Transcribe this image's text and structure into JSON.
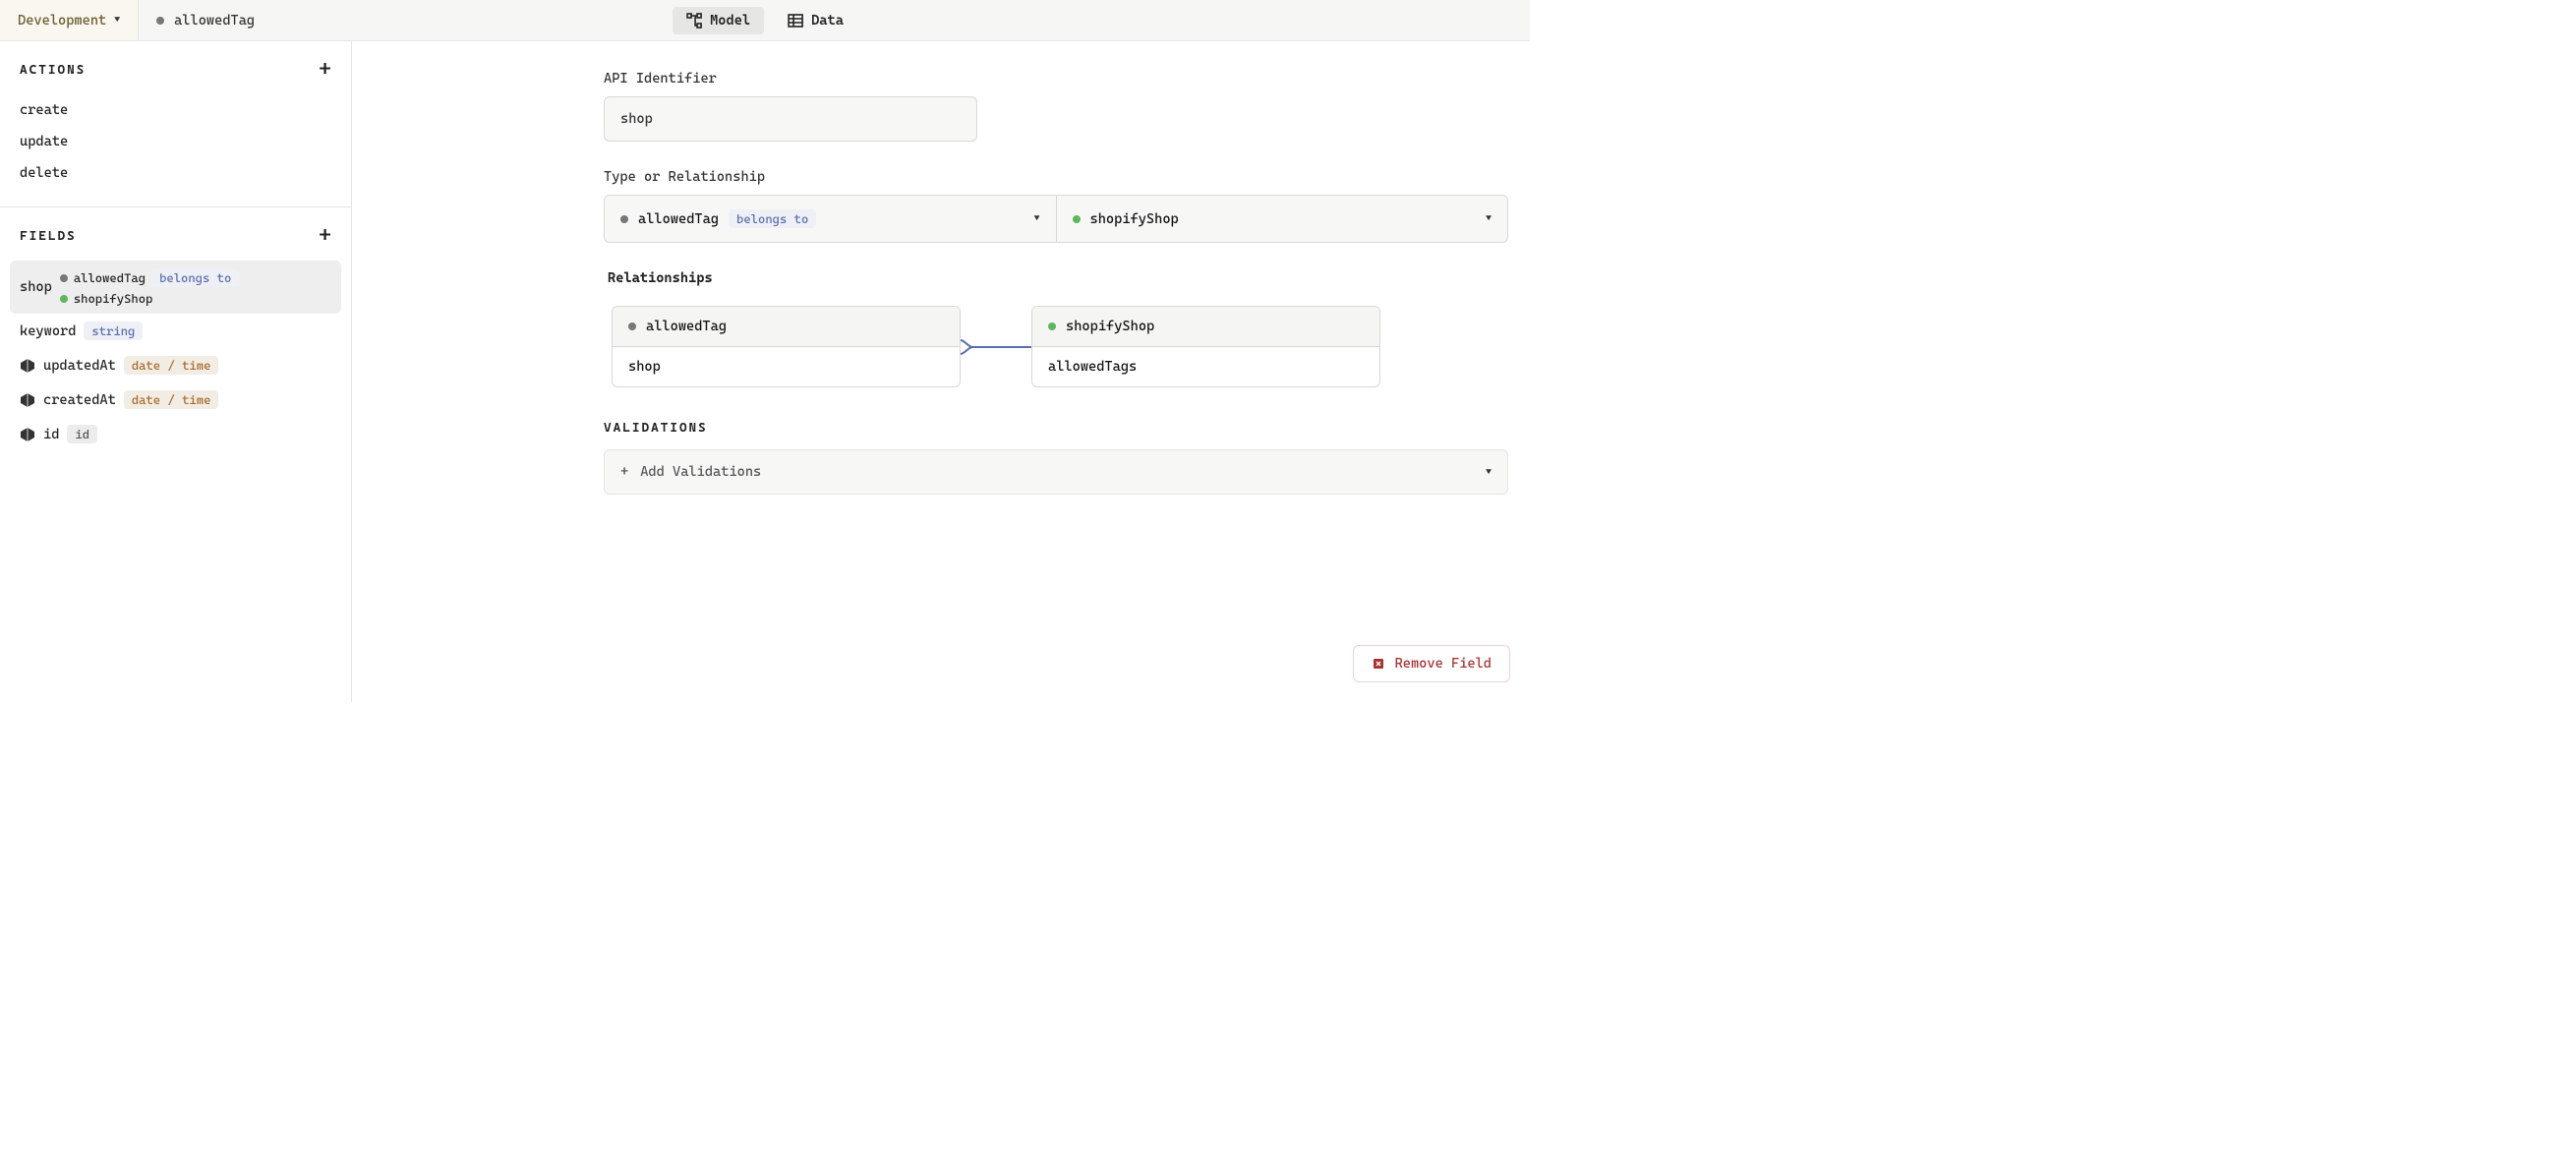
{
  "topbar": {
    "env_label": "Development",
    "breadcrumb_model": "allowedTag",
    "tabs": {
      "model": "Model",
      "data": "Data"
    }
  },
  "sidebar": {
    "actions": {
      "title": "ACTIONS",
      "items": [
        "create",
        "update",
        "delete"
      ]
    },
    "fields": {
      "title": "FIELDS",
      "items": [
        {
          "name": "shop",
          "selected": true,
          "rel": {
            "from": "allowedTag",
            "type": "belongs to",
            "to": "shopifyShop"
          }
        },
        {
          "name": "keyword",
          "badge": "string",
          "badgeClass": ""
        },
        {
          "name": "updatedAt",
          "badge": "date / time",
          "badgeClass": "orange",
          "sys": true
        },
        {
          "name": "createdAt",
          "badge": "date / time",
          "badgeClass": "orange",
          "sys": true
        },
        {
          "name": "id",
          "badge": "id",
          "badgeClass": "gray",
          "sys": true
        }
      ]
    }
  },
  "content": {
    "api_identifier_label": "API Identifier",
    "api_identifier_value": "shop",
    "type_label": "Type or Relationship",
    "type_select": {
      "model": "allowedTag",
      "rel": "belongs to",
      "target": "shopifyShop"
    },
    "relationships": {
      "title": "Relationships",
      "left": {
        "title": "allowedTag",
        "field": "shop"
      },
      "right": {
        "title": "shopifyShop",
        "field": "allowedTags"
      }
    },
    "validations": {
      "title": "VALIDATIONS",
      "add_label": "Add Validations"
    },
    "remove_label": "Remove Field"
  }
}
